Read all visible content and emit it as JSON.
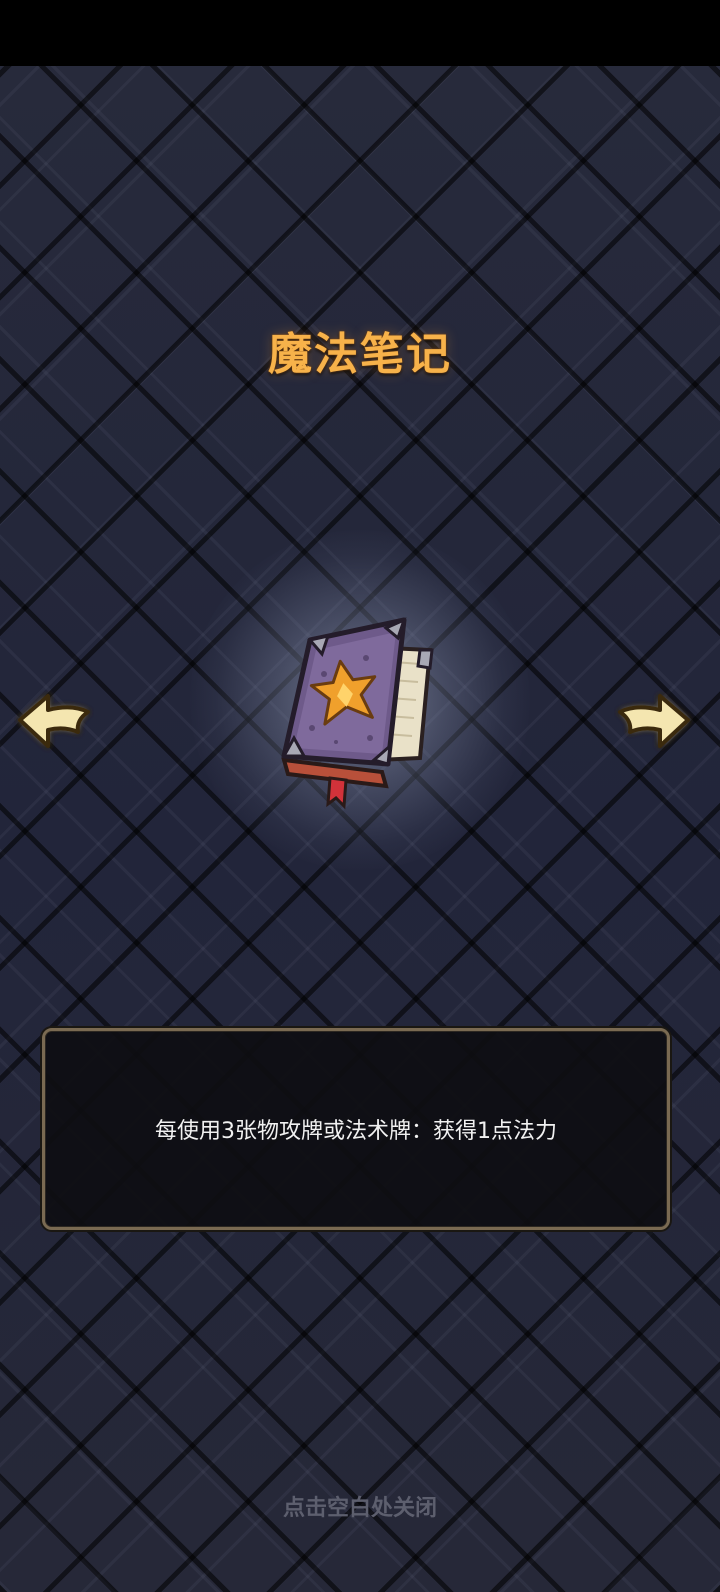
{
  "item": {
    "title": "魔法笔记",
    "description": "每使用3张物攻牌或法术牌：获得1点法力",
    "icon": "spellbook-icon"
  },
  "navigation": {
    "prev_icon": "arrow-left-icon",
    "next_icon": "arrow-right-icon"
  },
  "footer": {
    "close_hint": "点击空白处关闭"
  },
  "colors": {
    "title": "#f7b24a",
    "background": "#232637",
    "box_border": "#7a6a52",
    "hint": "#5d5f6e"
  }
}
